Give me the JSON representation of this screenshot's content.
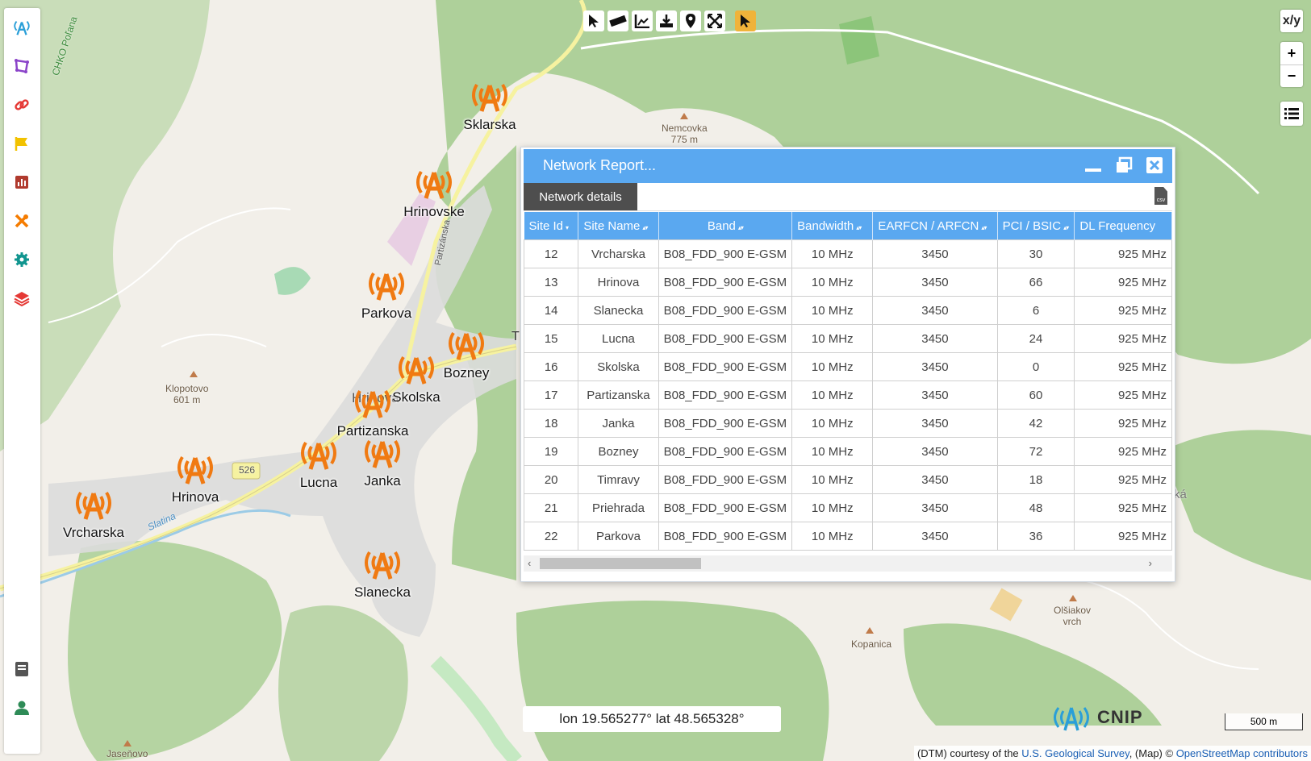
{
  "map": {
    "labels": {
      "chko": "CHKO Poľana",
      "nemcovka_name": "Nemcovka",
      "nemcovka_elev": "775 m",
      "klopotovo_name": "Klopotovo",
      "klopotovo_elev": "601 m",
      "olsiakov_line1": "Olšiakov",
      "olsiakov_line2": "vrch",
      "kopanica": "Kopanica",
      "jasenovo": "Jaseňovo",
      "road": "526",
      "slatina": "Slatina",
      "partizanska_road": "Partizánska",
      "hrinova_town": "Hriňová",
      "ka_fragment": "ká",
      "t_fragment": "T"
    }
  },
  "sites": [
    {
      "name": "Sklarska"
    },
    {
      "name": "Hrinovske"
    },
    {
      "name": "Parkova"
    },
    {
      "name": "Bozney"
    },
    {
      "name": "Skolska"
    },
    {
      "name": "Partizanska"
    },
    {
      "name": "Lucna"
    },
    {
      "name": "Janka"
    },
    {
      "name": "Hrinova"
    },
    {
      "name": "Vrcharska"
    },
    {
      "name": "Slanecka"
    }
  ],
  "sidebar": {
    "items": [
      {
        "icon": "antenna-icon",
        "color": "#2a9fd8"
      },
      {
        "icon": "polygon-icon",
        "color": "#8b44c9"
      },
      {
        "icon": "link-icon",
        "color": "#e53935"
      },
      {
        "icon": "flag-icon",
        "color": "#f2c200"
      },
      {
        "icon": "bar-chart-icon",
        "color": "#b03a2e"
      },
      {
        "icon": "tools-icon",
        "color": "#f57c00"
      },
      {
        "icon": "gear-icon",
        "color": "#10958f"
      },
      {
        "icon": "layers-icon",
        "color": "#e53935"
      },
      {
        "icon": "book-icon",
        "color": "#555555"
      },
      {
        "icon": "user-icon",
        "color": "#2e8b57"
      }
    ]
  },
  "controls": {
    "xy_label": "x/y",
    "zoom_in": "+",
    "zoom_out": "−"
  },
  "dialog": {
    "title": "Network Report...",
    "tab_label": "Network details",
    "csv_label": "csv",
    "columns": [
      "Site Id",
      "Site Name",
      "Band",
      "Bandwidth",
      "EARFCN / ARFCN",
      "PCI / BSIC",
      "DL Frequency"
    ],
    "rows": [
      [
        "12",
        "Vrcharska",
        "B08_FDD_900 E-GSM",
        "10 MHz",
        "3450",
        "30",
        "925 MHz"
      ],
      [
        "13",
        "Hrinova",
        "B08_FDD_900 E-GSM",
        "10 MHz",
        "3450",
        "66",
        "925 MHz"
      ],
      [
        "14",
        "Slanecka",
        "B08_FDD_900 E-GSM",
        "10 MHz",
        "3450",
        "6",
        "925 MHz"
      ],
      [
        "15",
        "Lucna",
        "B08_FDD_900 E-GSM",
        "10 MHz",
        "3450",
        "24",
        "925 MHz"
      ],
      [
        "16",
        "Skolska",
        "B08_FDD_900 E-GSM",
        "10 MHz",
        "3450",
        "0",
        "925 MHz"
      ],
      [
        "17",
        "Partizanska",
        "B08_FDD_900 E-GSM",
        "10 MHz",
        "3450",
        "60",
        "925 MHz"
      ],
      [
        "18",
        "Janka",
        "B08_FDD_900 E-GSM",
        "10 MHz",
        "3450",
        "42",
        "925 MHz"
      ],
      [
        "19",
        "Bozney",
        "B08_FDD_900 E-GSM",
        "10 MHz",
        "3450",
        "72",
        "925 MHz"
      ],
      [
        "20",
        "Timravy",
        "B08_FDD_900 E-GSM",
        "10 MHz",
        "3450",
        "18",
        "925 MHz"
      ],
      [
        "21",
        "Priehrada",
        "B08_FDD_900 E-GSM",
        "10 MHz",
        "3450",
        "48",
        "925 MHz"
      ],
      [
        "22",
        "Parkova",
        "B08_FDD_900 E-GSM",
        "10 MHz",
        "3450",
        "36",
        "925 MHz"
      ]
    ]
  },
  "status": {
    "coords": "lon 19.565277° lat 48.565328°",
    "scale": "500 m",
    "logo_text": "CNIP",
    "attribution_prefix": "(DTM) courtesy of the ",
    "attribution_usgs": "U.S. Geological Survey",
    "attribution_mid": ", (Map) © ",
    "attribution_osm": "OpenStreetMap contributors"
  },
  "colors": {
    "accent": "#5aa8f0",
    "tower": "#f07a12",
    "forest": "#b0d39a",
    "urban": "#dcdcdc"
  }
}
